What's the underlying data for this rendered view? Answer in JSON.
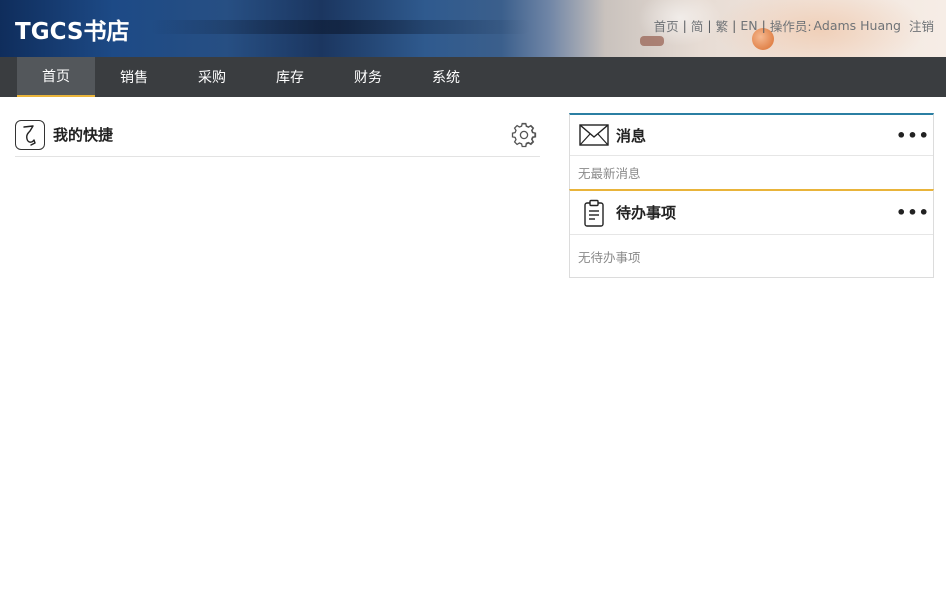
{
  "header": {
    "site_title": "TGCS书店",
    "links": {
      "home": "首页",
      "simplified": "简",
      "traditional": "繁",
      "english": "EN",
      "operator_label": "操作员:",
      "operator_name": "Adams Huang",
      "logout": "注销"
    },
    "separator": "|"
  },
  "nav": {
    "items": [
      {
        "label": "首页",
        "active": true
      },
      {
        "label": "销售",
        "active": false
      },
      {
        "label": "采购",
        "active": false
      },
      {
        "label": "库存",
        "active": false
      },
      {
        "label": "财务",
        "active": false
      },
      {
        "label": "系统",
        "active": false
      }
    ],
    "active_color": "#e9b43a"
  },
  "shortcuts": {
    "title": "我的快捷",
    "icon": "shortcut-icon",
    "settings_icon": "gear-icon"
  },
  "messages": {
    "title": "消息",
    "icon": "envelope-icon",
    "more": "•••",
    "empty_text": "无最新消息",
    "accent": "#2b7fa3"
  },
  "todo": {
    "title": "待办事项",
    "icon": "clipboard-icon",
    "more": "•••",
    "empty_text": "无待办事项",
    "accent": "#e9b43a"
  }
}
